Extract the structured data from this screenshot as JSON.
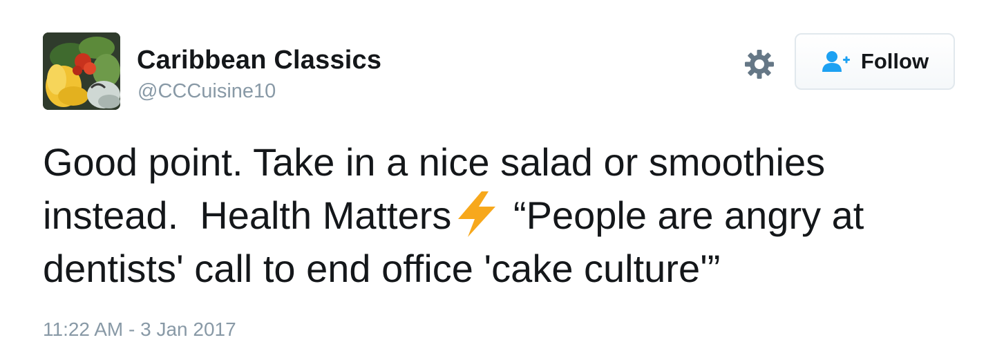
{
  "author": {
    "display_name": "Caribbean Classics",
    "handle": "@CCCuisine10"
  },
  "actions": {
    "settings_icon": "gear-icon",
    "follow_label": "Follow",
    "follow_icon": "add-user-icon"
  },
  "tweet": {
    "text_part1": "Good point. Take in a nice salad or smoothies\ninstead.  Health Matters",
    "emoji": "high-voltage-emoji",
    "text_part2": " “People are angry at\ndentists' call to end office 'cake culture'”",
    "timestamp": "11:22 AM - 3 Jan 2017"
  },
  "colors": {
    "text": "#14171a",
    "muted": "#8899a6",
    "accent": "#1da1f2",
    "bolt": "#f7a81c"
  }
}
